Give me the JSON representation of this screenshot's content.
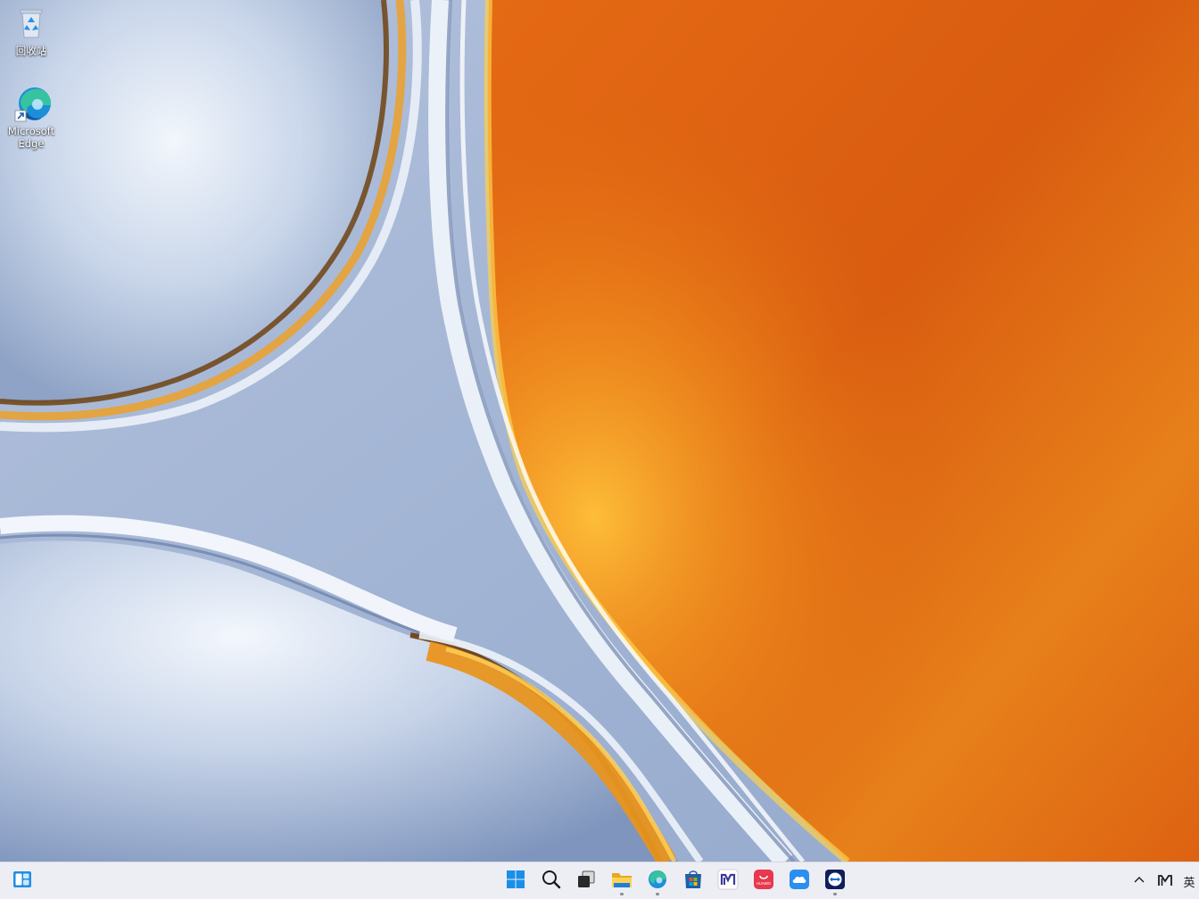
{
  "desktop": {
    "icons": [
      {
        "id": "recycle-bin",
        "label": "回收站",
        "icon": "recycle-bin-icon"
      },
      {
        "id": "microsoft-edge",
        "label": "Microsoft\nEdge",
        "icon": "edge-icon"
      }
    ]
  },
  "taskbar": {
    "left": [
      {
        "id": "widgets",
        "icon": "widgets-icon"
      }
    ],
    "center": [
      {
        "id": "start",
        "icon": "windows-start-icon"
      },
      {
        "id": "search",
        "icon": "search-icon"
      },
      {
        "id": "task-view",
        "icon": "task-view-icon"
      },
      {
        "id": "file-explorer",
        "icon": "folder-icon",
        "running": true
      },
      {
        "id": "edge",
        "icon": "edge-icon",
        "running": true
      },
      {
        "id": "store",
        "icon": "store-icon"
      },
      {
        "id": "app-m",
        "icon": "m-app-icon"
      },
      {
        "id": "appgallery",
        "icon": "appgallery-icon",
        "text": "HUAWEI"
      },
      {
        "id": "cloud",
        "icon": "cloud-icon"
      },
      {
        "id": "teamviewer",
        "icon": "teamviewer-icon",
        "running": true
      }
    ],
    "tray": {
      "chevron_icon": "chevron-up-icon",
      "app_icon": "m-app-icon",
      "ime": "英"
    }
  },
  "colors": {
    "wallpaper_orange": "#e06a12",
    "wallpaper_blue": "#a9b9d7",
    "taskbar_bg": "#ececf4"
  }
}
